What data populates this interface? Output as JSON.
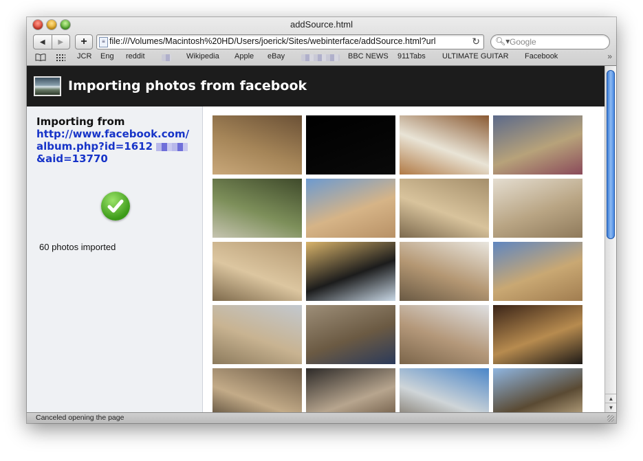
{
  "window": {
    "title": "addSource.html"
  },
  "toolbar": {
    "back_icon": "back-arrow",
    "forward_icon": "forward-arrow",
    "add_icon": "+",
    "url": "file:///Volumes/Macintosh%20HD/Users/joerick/Sites/webinterface/addSource.html?url",
    "search_placeholder": "Google"
  },
  "bookmarks": [
    "JCR",
    "Eng",
    "reddit",
    "Wikipedia",
    "Apple",
    "eBay",
    "BBC NEWS",
    "911Tabs",
    "ULTIMATE GUITAR",
    "Facebook"
  ],
  "header": {
    "title": "Importing photos from facebook"
  },
  "sidebar": {
    "importing_label": "Importing from",
    "link_part1": "http://www.facebook.com/album.php?id=1612",
    "link_part2": "&aid=13770",
    "count_text": "60 photos imported"
  },
  "photos": [
    {
      "colors": [
        "#6b5136",
        "#a58558",
        "#c9a87a"
      ]
    },
    {
      "colors": [
        "#000000",
        "#050505",
        "#0a0a0a"
      ]
    },
    {
      "colors": [
        "#8a5a33",
        "#e9e4d6",
        "#b17a45"
      ]
    },
    {
      "colors": [
        "#5c6a8a",
        "#b7a27a",
        "#8a4a5a"
      ]
    },
    {
      "colors": [
        "#3f4a2b",
        "#7d8f5a",
        "#c6c4b0"
      ]
    },
    {
      "colors": [
        "#6c9ad0",
        "#d6b487",
        "#b89166"
      ]
    },
    {
      "colors": [
        "#a58f6b",
        "#d8c39c",
        "#7d6a4e"
      ]
    },
    {
      "colors": [
        "#e4ddd0",
        "#b9a584",
        "#8f7a5b"
      ]
    },
    {
      "colors": [
        "#b59a73",
        "#dcc6a0",
        "#7e6a4c"
      ]
    },
    {
      "colors": [
        "#d8b36a",
        "#1c1c1c",
        "#c9d8e6"
      ]
    },
    {
      "colors": [
        "#e9e6df",
        "#b49773",
        "#6a5a44"
      ]
    },
    {
      "colors": [
        "#5f86c0",
        "#c9a873",
        "#a17d50"
      ]
    },
    {
      "colors": [
        "#c2c8cf",
        "#c8b391",
        "#8c7a5c"
      ]
    },
    {
      "colors": [
        "#9d8e78",
        "#6b5a43",
        "#2b3a5a"
      ]
    },
    {
      "colors": [
        "#dfe0e2",
        "#b4987a",
        "#7b654a"
      ]
    },
    {
      "colors": [
        "#3a2418",
        "#b78b4f",
        "#1e1a17"
      ]
    },
    {
      "colors": [
        "#6f5d48",
        "#c3ab88",
        "#3e3325"
      ]
    },
    {
      "colors": [
        "#2d2a28",
        "#b7a58e",
        "#5a4632"
      ]
    },
    {
      "colors": [
        "#4b86c8",
        "#cfd5d8",
        "#6e6252"
      ]
    },
    {
      "colors": [
        "#8fb5e0",
        "#5a4a33",
        "#d8c29a"
      ]
    }
  ],
  "status": {
    "text": "Canceled opening the page"
  }
}
